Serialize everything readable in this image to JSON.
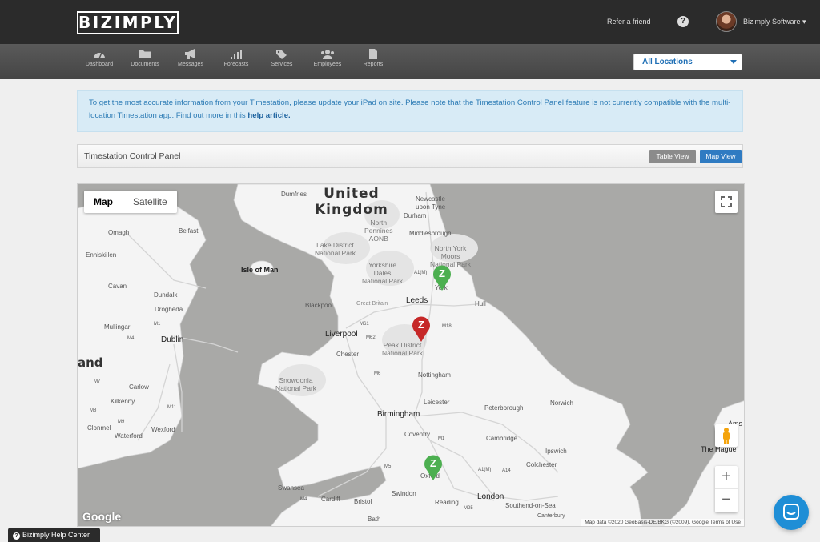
{
  "header": {
    "logo_text": "BIZIMPLY",
    "refer_link": "Refer a friend",
    "help_icon_glyph": "?",
    "account_name": "Bizimply Software"
  },
  "nav": {
    "items": [
      {
        "label": "Dashboard",
        "icon": "dashboard-icon"
      },
      {
        "label": "Documents",
        "icon": "folder-icon"
      },
      {
        "label": "Messages",
        "icon": "megaphone-icon"
      },
      {
        "label": "Forecasts",
        "icon": "bar-chart-icon"
      },
      {
        "label": "Services",
        "icon": "tags-icon"
      },
      {
        "label": "Employees",
        "icon": "users-icon"
      },
      {
        "label": "Reports",
        "icon": "document-icon"
      }
    ],
    "location_select": "All Locations"
  },
  "notice": {
    "text": "To get the most accurate information from your Timestation, please update your iPad on site. Please note that the Timestation Control Panel feature is not currently compatible with the multi-location Timestation app. Find out more in this",
    "link": "help article."
  },
  "panel": {
    "title": "Timestation Control Panel",
    "table_view": "Table View",
    "map_view": "Map View"
  },
  "map": {
    "type_map": "Map",
    "type_satellite": "Satellite",
    "country_label": "United\nKingdom",
    "labels": {
      "dumfries": "Dumfries",
      "newcastle": "Newcastle\nupon Tyne",
      "durham": "Durham",
      "north_pennines": "North\nPennines\nAONB",
      "middlesbrough": "Middlesbrough",
      "north_york_moors": "North York\nMoors\nNational Park",
      "lake_district": "Lake District\nNational Park",
      "yorkshire_dales": "Yorkshire\nDales\nNational Park",
      "york": "York",
      "belfast": "Belfast",
      "omagh": "Omagh",
      "enniskillen": "Enniskillen",
      "isle_of_man": "Isle of Man",
      "cavan": "Cavan",
      "dundalk": "Dundalk",
      "drogheda": "Drogheda",
      "blackpool": "Blackpool",
      "great_britain": "Great Britain",
      "leeds": "Leeds",
      "hull": "Hull",
      "mullingar": "Mullingar",
      "liverpool": "Liverpool",
      "chester": "Chester",
      "peak_district": "Peak District\nNational Park",
      "dublin": "Dublin",
      "ireland_partial": "and",
      "snowdonia": "Snowdonia\nNational Park",
      "nottingham": "Nottingham",
      "carlow": "Carlow",
      "kilkenny": "Kilkenny",
      "norwich": "Norwich",
      "leicester": "Leicester",
      "peterborough": "Peterborough",
      "birmingham": "Birmingham",
      "clonmel": "Clonmel",
      "wexford": "Wexford",
      "waterford": "Waterford",
      "coventry": "Coventry",
      "cambridge": "Cambridge",
      "ipswich": "Ipswich",
      "the_hague": "The Hague",
      "amsterdam_partial": "Ams",
      "colchester": "Colchester",
      "oxford": "Oxford",
      "swansea": "Swansea",
      "cardiff": "Cardiff",
      "bristol": "Bristol",
      "swindon": "Swindon",
      "reading": "Reading",
      "london": "London",
      "southend": "Southend-on-Sea",
      "bath": "Bath",
      "canterbury": "Canterbury",
      "road_a1m": "A1(M)",
      "road_a1m_south": "A1(M)",
      "road_m61": "M61",
      "road_m62": "M62",
      "road_m18": "M18",
      "road_m6": "M6",
      "road_m1": "M1",
      "road_m5": "M5",
      "road_m25": "M25",
      "road_m4": "M4",
      "road_m4_ireland": "M4",
      "road_m7": "M7",
      "road_m9": "M9",
      "road_m8": "M8",
      "road_m11": "M11",
      "road_m1_ireland": "M1",
      "road_a14": "A14"
    },
    "markers": [
      {
        "name": "york",
        "color": "#4caf50",
        "glyph": "Z"
      },
      {
        "name": "sheffield",
        "color": "#c62828",
        "glyph": "Z"
      },
      {
        "name": "oxford",
        "color": "#4caf50",
        "glyph": "Z"
      }
    ],
    "google_logo": "Google",
    "attribution": "Map data ©2020 GeoBasis-DE/BKG (©2009), Google    Terms of Use",
    "zoom_in": "+",
    "zoom_out": "−"
  },
  "footer": {
    "help_center": "Bizimply Help Center",
    "help_center_icon": "?"
  },
  "colors": {
    "topbar": "#2b2b2b",
    "accent": "#2f7bc2",
    "notice_bg": "#d8ebf6",
    "marker_green": "#4caf50",
    "marker_red": "#c62828"
  }
}
